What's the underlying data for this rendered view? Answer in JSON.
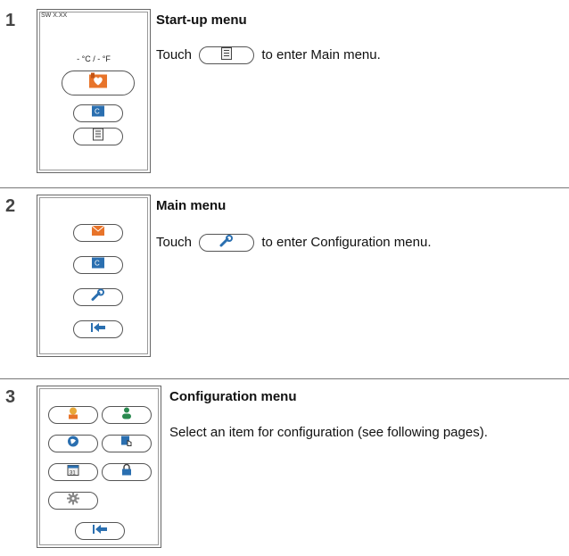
{
  "steps": [
    {
      "number": "1",
      "title": "Start-up menu",
      "text_before": "Touch",
      "text_after": "to enter Main menu.",
      "screen": {
        "sw_label": "SW X.XX",
        "temp_readout": "- °C /  - °F",
        "buttons": [
          "heart-home-icon",
          "thermostat-c-icon",
          "menu-list-icon"
        ]
      }
    },
    {
      "number": "2",
      "title": "Main menu",
      "text_before": "Touch",
      "text_after": "to enter Configuration menu.",
      "screen": {
        "buttons": [
          "envelope-heart-icon",
          "thermostat-c-icon",
          "wrench-icon",
          "back-arrow-icon"
        ]
      }
    },
    {
      "number": "3",
      "title": "Configuration menu",
      "text": "Select an item for configuration (see following pages).",
      "screen": {
        "buttons": [
          "user-profile-icon",
          "user-green-icon",
          "globe-icon",
          "touch-hand-icon",
          "calendar-icon",
          "lock-icon",
          "gear-icon",
          "back-arrow-icon"
        ]
      }
    }
  ],
  "colors": {
    "accent_orange": "#e8742a",
    "accent_blue": "#2a6fb0",
    "border": "#555555"
  }
}
